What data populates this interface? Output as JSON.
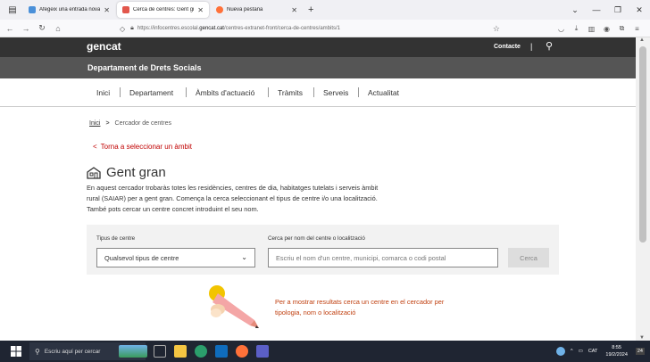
{
  "browser": {
    "tabs": [
      {
        "title": "Afegeix una entrada nova ‹ Boo",
        "favicon_color": "#4a90d9"
      },
      {
        "title": "Cerca de centres: Gent gran",
        "favicon_color": "#e2574c",
        "active": true
      },
      {
        "title": "Nueva pestaña",
        "favicon_color": "#ff7139"
      }
    ],
    "url_prefix": "https://infocentres.escolal.",
    "url_domain": "gencat.cat",
    "url_suffix": "/centres-extranet-front/cerca-de-centres/ambits/1"
  },
  "site": {
    "logo": "gencat",
    "contact": "Contacte",
    "separator": "|",
    "department": "Departament de Drets Socials",
    "menu": [
      "Inici",
      "Departament",
      "Àmbits d'actuació",
      "Tràmits",
      "Serveis",
      "Actualitat"
    ]
  },
  "breadcrumb": {
    "home": "Inici",
    "current": "Cercador de centres",
    "separator": ">"
  },
  "back_link": "Torna a seleccionar un àmbit",
  "page_title": "Gent gran",
  "intro": "En aquest cercador trobaràs totes les residències, centres de dia, habitatges tutelats i serveis àmbit rural (SAIAR) per a gent gran. Comença la cerca seleccionant el tipus de centre i/o una localització. També pots cercar un centre concret introduint el seu nom.",
  "filter": {
    "type_label": "Tipus de centre",
    "type_value": "Qualsevol tipus de centre",
    "search_label": "Cerca per nom del centre o localització",
    "search_placeholder": "Escriu el nom d'un centre, municipi, comarca o codi postal",
    "search_button": "Cerca"
  },
  "hint": "Per a mostrar resultats cerca un centre en el cercador per tipologia, nom o localització",
  "taskbar": {
    "search_placeholder": "Escriu aquí per cercar",
    "language": "CAT",
    "time": "8:55",
    "date": "19/2/2024",
    "notifications": "24"
  },
  "colors": {
    "header_dark": "#333333",
    "dept_bar": "#555555",
    "accent_red": "#c00000",
    "hint_orange": "#c04010",
    "taskbar": "#1f2532"
  }
}
